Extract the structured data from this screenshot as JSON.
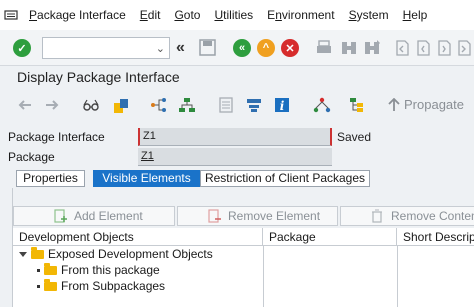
{
  "menubar": {
    "items": [
      {
        "label": "Package Interface",
        "underline": "P",
        "rest": "ackage Interface"
      },
      {
        "label": "Edit",
        "underline": "E",
        "rest": "dit"
      },
      {
        "label": "Goto",
        "underline": "G",
        "rest": "oto"
      },
      {
        "label": "Utilities",
        "underline": "U",
        "rest": "tilities"
      },
      {
        "label": "Environment",
        "underline": "n",
        "rest": "vironment"
      },
      {
        "label": "System",
        "underline": "S",
        "rest": "ystem"
      },
      {
        "label": "Help",
        "underline": "H",
        "rest": "elp"
      }
    ]
  },
  "toolbar": {
    "command_value": ""
  },
  "title": {
    "text": "Display Package Interface"
  },
  "apptoolbar": {
    "propagate_label": "Propagate"
  },
  "form": {
    "package_interface_label": "Package Interface",
    "package_interface_value": "Z1",
    "status": "Saved",
    "package_label": "Package",
    "package_value": "Z1"
  },
  "tabs": [
    {
      "label": "Properties",
      "active": false
    },
    {
      "label": "Visible Elements",
      "active": true
    },
    {
      "label": "Restriction of Client Packages",
      "active": false
    }
  ],
  "buttons": {
    "add": "Add Element",
    "remove": "Remove Element",
    "remove_content": "Remove Content"
  },
  "grid": {
    "headers": [
      "Development Objects",
      "Package",
      "Short Description"
    ],
    "rows": [
      {
        "label": "Exposed Development Objects"
      },
      {
        "label": "From this package"
      },
      {
        "label": "From Subpackages"
      }
    ]
  },
  "colors": {
    "accent": "#1a73c9",
    "ok_green": "#2e9e3e",
    "orange": "#f0a020",
    "red": "#d62c2c"
  }
}
